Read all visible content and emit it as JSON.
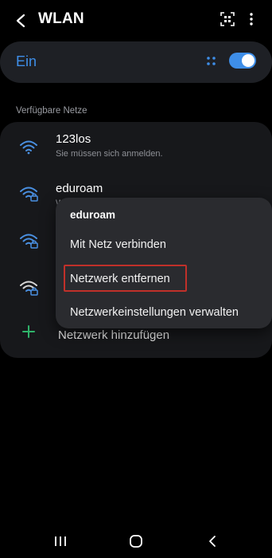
{
  "header": {
    "title": "WLAN",
    "back_icon": "back-arrow-icon",
    "scan_icon": "qr-scan-icon",
    "more_icon": "more-vert-icon"
  },
  "wifi_switch": {
    "label": "Ein",
    "state": "on",
    "accent_color": "#3e8ee8"
  },
  "available": {
    "section_label": "Verfügbare Netze",
    "networks": [
      {
        "name": "123los",
        "subtitle": "Sie müssen sich anmelden.",
        "icon": "wifi-icon",
        "locked": false
      },
      {
        "name": "eduroam",
        "subtitle": "W",
        "icon": "wifi-lock-icon",
        "locked": true
      },
      {
        "name": "",
        "icon": "wifi-lock-icon",
        "locked": true
      },
      {
        "name": "",
        "icon": "wifi-lock-icon",
        "locked": true
      }
    ],
    "add_label": "Netzwerk hinzufügen"
  },
  "context_menu": {
    "title": "eduroam",
    "items": [
      {
        "label": "Mit Netz verbinden"
      },
      {
        "label": "Netzwerk entfernen",
        "highlighted": true
      },
      {
        "label": "Netzwerkeinstellungen verwalten"
      }
    ]
  },
  "navbar": {
    "recent_icon": "recent-apps-icon",
    "home_icon": "home-icon",
    "back_icon": "nav-back-icon"
  }
}
